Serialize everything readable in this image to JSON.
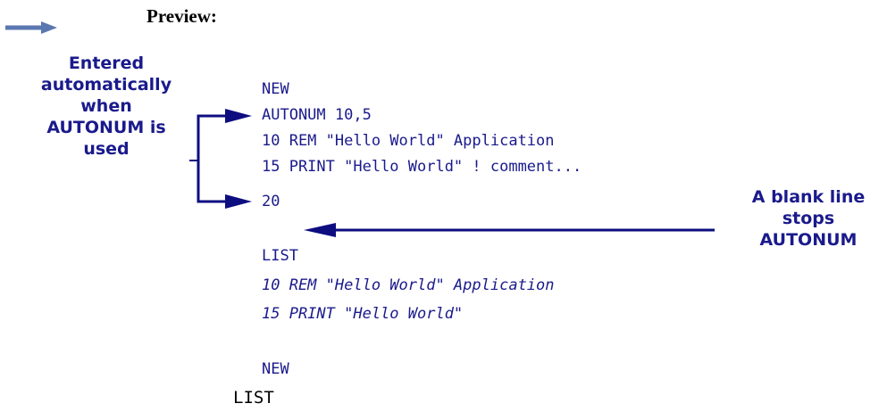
{
  "preview": {
    "title": "Preview:"
  },
  "callouts": {
    "left": {
      "line1": "Entered",
      "line2": "automatically",
      "line3": "when",
      "line4": "AUTONUM is",
      "line5": "used"
    },
    "right": {
      "line1": "A blank line",
      "line2": "stops",
      "line3": "AUTONUM"
    }
  },
  "code": {
    "line_new_1": "NEW",
    "line_autonum": "AUTONUM 10,5",
    "line_10": "10 REM \"Hello World\" Application",
    "line_15": "15 PRINT \"Hello World\" ! comment...",
    "line_20": "20",
    "line_list_1": "LIST",
    "list_out_10": "10 REM \"Hello World\" Application",
    "list_out_15": "15 PRINT \"Hello World\"",
    "line_new_2": "NEW",
    "line_list_2": "LIST"
  },
  "colors": {
    "code_text": "#1a1a8c",
    "callout_text": "#1a1a8c",
    "arrow_dark": "#0d0d80",
    "pointer_arrow": "#5b77b0"
  },
  "icons": {
    "preview_pointer": "right-arrow-icon"
  }
}
